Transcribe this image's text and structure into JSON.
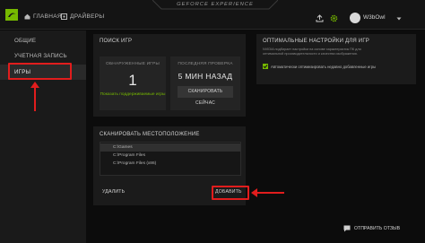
{
  "topbar": {
    "brand": "GEFORCE EXPERIENCE",
    "tabs": [
      {
        "label": "ГЛАВНАЯ",
        "icon": "home-icon"
      },
      {
        "label": "ДРАЙВЕРЫ",
        "icon": "drivers-icon"
      }
    ],
    "username": "W3bOwl"
  },
  "sidebar": {
    "items": [
      {
        "label": "ОБЩИЕ"
      },
      {
        "label": "УЧЕТНАЯ ЗАПИСЬ"
      },
      {
        "label": "ИГРЫ"
      }
    ]
  },
  "game_search": {
    "title": "ПОИСК ИГР",
    "found_label": "ОБНАРУЖЕННЫЕ ИГРЫ",
    "found_value": "1",
    "show_supported_link": "Показать поддерживаемые игры",
    "last_scan_label": "ПОСЛЕДНЯЯ ПРОВЕРКА",
    "last_scan_value": "5 МИН НАЗАД",
    "scan_now_button": "СКАНИРОВАТЬ СЕЙЧАС"
  },
  "optimal_settings": {
    "title": "ОПТИМАЛЬНЫЕ НАСТРОЙКИ ДЛЯ ИГР",
    "description_line1": "NVIDIA подбирает настройки на основе характеристик ПК для",
    "description_line2": "оптимальной производительности и качества изображения.",
    "checkbox_label": "Автоматически оптимизировать недавно добавленные игры",
    "checkbox_checked": true
  },
  "scan_location": {
    "title": "СКАНИРОВАТЬ МЕСТОПОЛОЖЕНИЕ",
    "paths": [
      "C:\\Games",
      "C:\\Program Files",
      "C:\\Program Files (x86)"
    ],
    "selected_index": 0,
    "remove_label": "УДАЛИТЬ",
    "add_label": "ДОБАВИТЬ"
  },
  "feedback": {
    "label": "ОТПРАВИТЬ ОТЗЫВ"
  },
  "colors": {
    "accent": "#76b900",
    "annotation": "#e11d1d"
  }
}
